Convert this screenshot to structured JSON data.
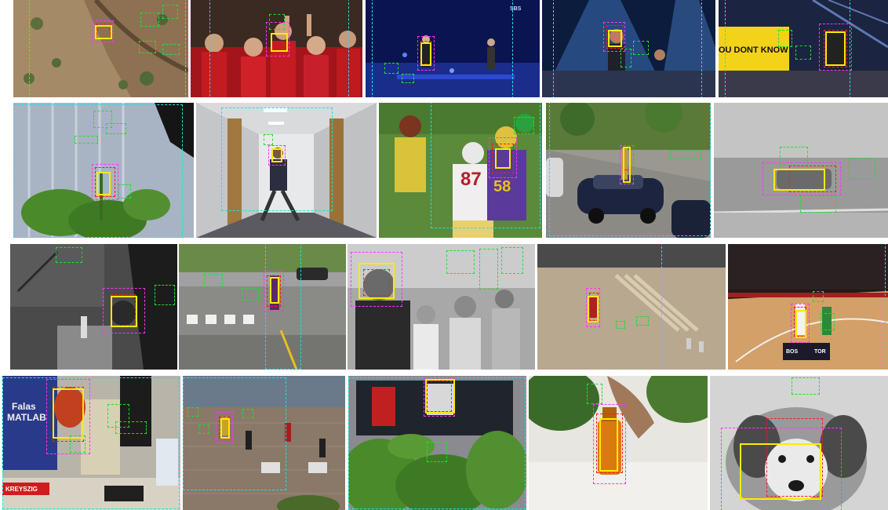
{
  "figure": {
    "panels": [
      {
        "id": "r1-cliff"
      },
      {
        "id": "r1-cheer"
      },
      {
        "id": "r1-stage-blue"
      },
      {
        "id": "r1-concert"
      },
      {
        "id": "r1-stage-yellow"
      },
      {
        "id": "r2-plant-hand"
      },
      {
        "id": "r2-hallway"
      },
      {
        "id": "r2-football"
      },
      {
        "id": "r2-street-car"
      },
      {
        "id": "r2-grey-road"
      },
      {
        "id": "r3-dark-room"
      },
      {
        "id": "r3-crosswalk"
      },
      {
        "id": "r3-classroom"
      },
      {
        "id": "r3-aerial-walk"
      },
      {
        "id": "r3-basketball"
      },
      {
        "id": "r4-desk"
      },
      {
        "id": "r4-plaza"
      },
      {
        "id": "r4-plant-tv"
      },
      {
        "id": "r4-bottle"
      },
      {
        "id": "r4-dog"
      }
    ],
    "overlay_text": {
      "stage_yellow": "OU DONT KNOW",
      "jersey_87": "87",
      "jersey_58": "58",
      "book_title_1": "Falas",
      "book_title_2": "MATLAB",
      "book_spine": "KREYSZIG",
      "score_left": "BOS",
      "score_right": "TOR",
      "broadcast_logo": "SBS"
    }
  }
}
